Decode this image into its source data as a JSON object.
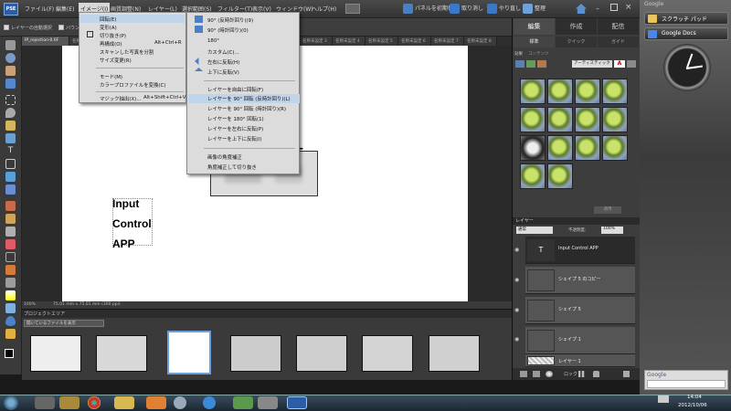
{
  "app": {
    "logo": "PSE",
    "menus": [
      "ファイル(F)",
      "編集(E)",
      "イメージ(I)",
      "画質調整(N)",
      "レイヤー(L)",
      "選択範囲(S)",
      "フィルター(T)",
      "表示(V)",
      "ウィンドウ(W)",
      "ヘルプ(H)"
    ],
    "top_buttons": {
      "reset": "パネルを初期化",
      "undo": "取り消し",
      "redo": "やり直し",
      "organize": "整理"
    }
  },
  "options_bar": {
    "auto_layer": "レイヤーの自動選択",
    "bounding": "バウンディ"
  },
  "doc_tabs": [
    "IP_rejection-0.6F",
    "名称未設定 1",
    "名称未設定 2",
    "名称未設定 3",
    "名称未設定 4",
    "名称未設定 5",
    "名称未設定 6",
    "名称未設定 7",
    "名称未設定 8"
  ],
  "image_menu": {
    "items": [
      {
        "label": "回転(E)",
        "shortcut": ""
      },
      {
        "label": "変形(A)",
        "shortcut": ""
      },
      {
        "label": "切り抜き(P)",
        "shortcut": ""
      },
      {
        "label": "再構成(O)",
        "shortcut": "Alt+Ctrl+R"
      },
      {
        "label": "スキャンした写真を分割",
        "shortcut": ""
      },
      {
        "label": "サイズ変更(R)",
        "shortcut": ""
      },
      {
        "label": "モード(M)",
        "shortcut": ""
      },
      {
        "label": "カラープロファイルを変換(C)",
        "shortcut": ""
      },
      {
        "label": "マジック抽出(X)...",
        "shortcut": "Alt+Shift+Ctrl+V"
      }
    ]
  },
  "rotate_menu": {
    "items": [
      "90° (反時計回り)(9)",
      "90° (時計回り)(0)",
      "180°",
      "カスタム(C)...",
      "左右に反転(H)",
      "上下に反転(V)",
      "レイヤーを自由に回転(F)",
      "レイヤーを 90° 回転 (反時計回り)(L)",
      "レイヤーを 90° 回転 (時計回り)(R)",
      "レイヤーを 180° 回転(1)",
      "レイヤーを左右に反転(P)",
      "レイヤーを上下に反転(I)",
      "画像の角度補正",
      "角度補正して切り抜き"
    ]
  },
  "canvas": {
    "lines": [
      "Input",
      "Control",
      "APP"
    ],
    "zoom": "100%",
    "doc_size": "75.01 mm x 75.01 mm (300 ppi)"
  },
  "project_bin": {
    "title": "プロジェクトエリア",
    "filter": "開いているファイルを表示"
  },
  "panel": {
    "tabs": [
      "編集",
      "作成",
      "配信"
    ],
    "subtabs": [
      "標準",
      "クイック",
      "ガイド"
    ],
    "effects_tabs": [
      "効果",
      "コンテンツ"
    ],
    "effects_filter": "アーティスティック",
    "apply": "適用",
    "layers_title": "レイヤー",
    "blend_mode": "通常",
    "opacity_label": "不透明度:",
    "opacity": "100%",
    "layers": [
      "Input Control APP",
      "シェイプ 5 のコピー",
      "シェイプ 5",
      "シェイプ 1",
      "レイヤー 1"
    ],
    "lock": "ロック"
  },
  "desktop": {
    "google": "Google",
    "gadgets": [
      "スクラッチ パッド",
      "Google Docs"
    ],
    "time": "14:04",
    "date": "2012/10/06"
  }
}
